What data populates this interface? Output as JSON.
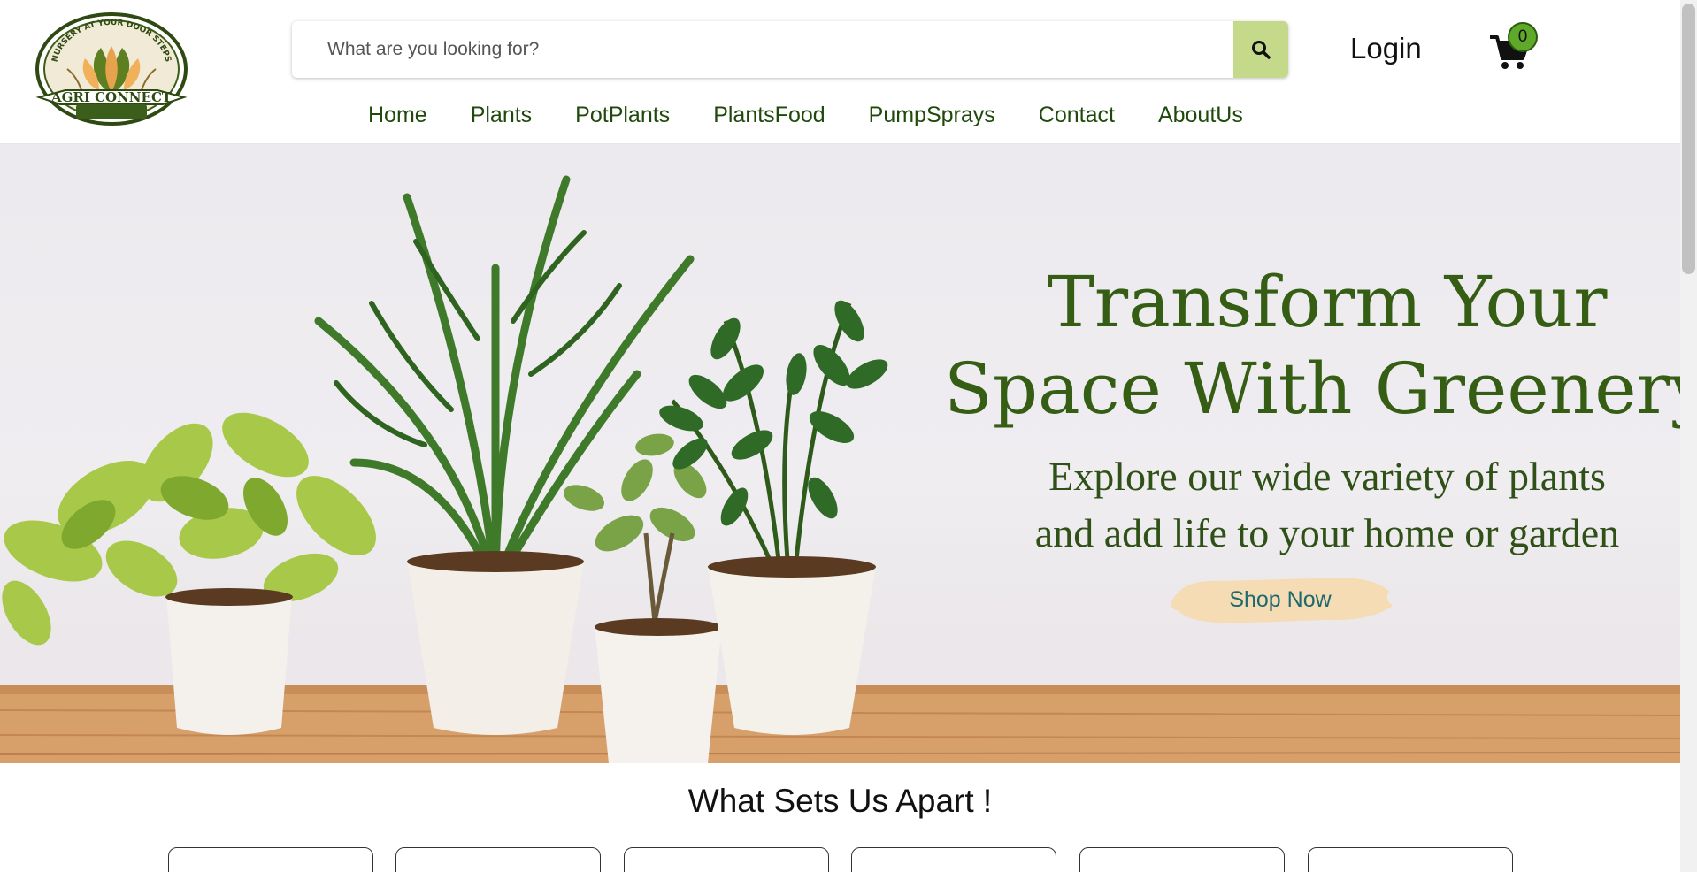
{
  "header": {
    "logo": {
      "top_text": "NURSERY AT YOUR DOOR STEPS",
      "brand": "AGRI CONNECT"
    },
    "search": {
      "placeholder": "What are you looking for?",
      "icon": "search-icon"
    },
    "login_label": "Login",
    "cart": {
      "icon": "cart-icon",
      "count": "0"
    }
  },
  "nav": {
    "items": [
      {
        "label": "Home"
      },
      {
        "label": "Plants"
      },
      {
        "label": "PotPlants"
      },
      {
        "label": "PlantsFood"
      },
      {
        "label": "PumpSprays"
      },
      {
        "label": "Contact"
      },
      {
        "label": "AboutUs"
      }
    ]
  },
  "hero": {
    "title_line1": "Transform Your",
    "title_line2": "Space With Greenery",
    "subtitle_line1": "Explore our wide variety of plants",
    "subtitle_line2": "and add life to your home or garden",
    "cta_label": "Shop Now"
  },
  "section": {
    "title": "What Sets Us Apart !"
  },
  "colors": {
    "nav_text": "#1f4a0c",
    "hero_title": "#355e14",
    "search_button": "#c5d98a",
    "cart_badge": "#5fa92a",
    "cta_text": "#1d6a6e",
    "cta_background": "#f5dcb5"
  }
}
